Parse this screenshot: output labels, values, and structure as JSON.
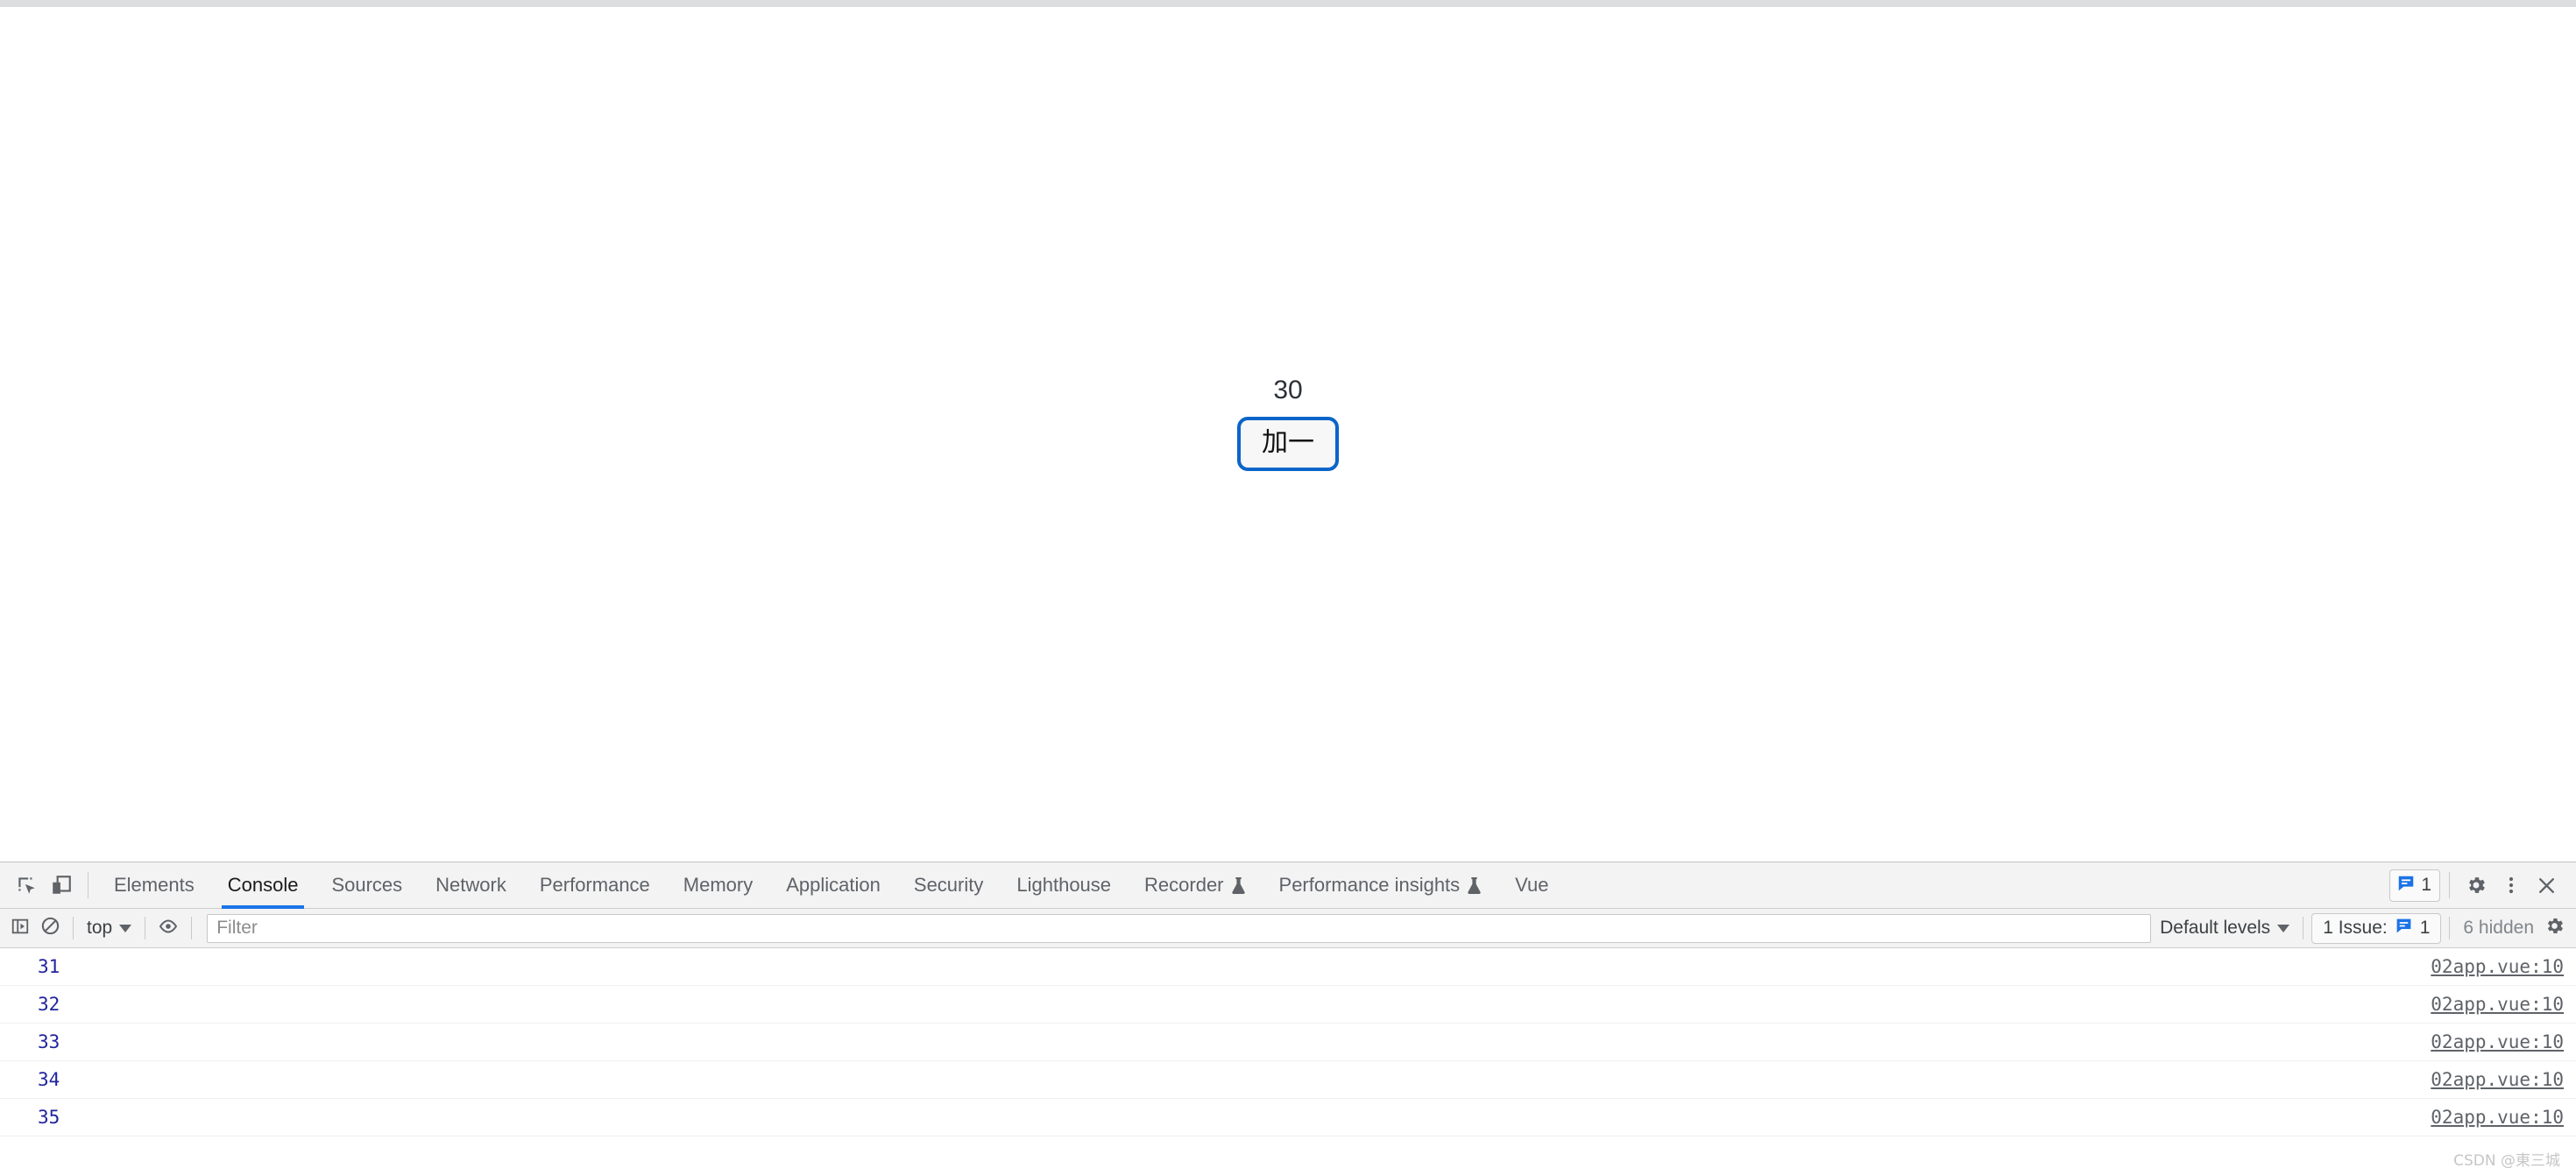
{
  "page": {
    "counter_value": "30",
    "increment_button_label": "加一"
  },
  "devtools": {
    "icons": {
      "inspect": "inspect-element-icon",
      "device": "device-toolbar-icon"
    },
    "tabs": [
      {
        "label": "Elements",
        "active": false,
        "experimental": false
      },
      {
        "label": "Console",
        "active": true,
        "experimental": false
      },
      {
        "label": "Sources",
        "active": false,
        "experimental": false
      },
      {
        "label": "Network",
        "active": false,
        "experimental": false
      },
      {
        "label": "Performance",
        "active": false,
        "experimental": false
      },
      {
        "label": "Memory",
        "active": false,
        "experimental": false
      },
      {
        "label": "Application",
        "active": false,
        "experimental": false
      },
      {
        "label": "Security",
        "active": false,
        "experimental": false
      },
      {
        "label": "Lighthouse",
        "active": false,
        "experimental": false
      },
      {
        "label": "Recorder",
        "active": false,
        "experimental": true
      },
      {
        "label": "Performance insights",
        "active": false,
        "experimental": true
      },
      {
        "label": "Vue",
        "active": false,
        "experimental": false
      }
    ],
    "tabbar_issues_count": "1",
    "console_toolbar": {
      "context_selector": "top",
      "filter_placeholder": "Filter",
      "filter_value": "",
      "log_levels": "Default levels",
      "issues_label": "1 Issue:",
      "issues_count": "1",
      "hidden_label": "6 hidden"
    },
    "messages": [
      {
        "text": "31",
        "source": "02app.vue:10"
      },
      {
        "text": "32",
        "source": "02app.vue:10"
      },
      {
        "text": "33",
        "source": "02app.vue:10"
      },
      {
        "text": "34",
        "source": "02app.vue:10"
      },
      {
        "text": "35",
        "source": "02app.vue:10"
      }
    ],
    "prompt_chevron": "❯"
  },
  "watermark": "CSDN @東三城",
  "colors": {
    "accent_blue": "#1a73e8",
    "focus_ring": "#0b65c9",
    "log_text_blue": "#20249c",
    "issue_blue": "#1a73e8"
  }
}
